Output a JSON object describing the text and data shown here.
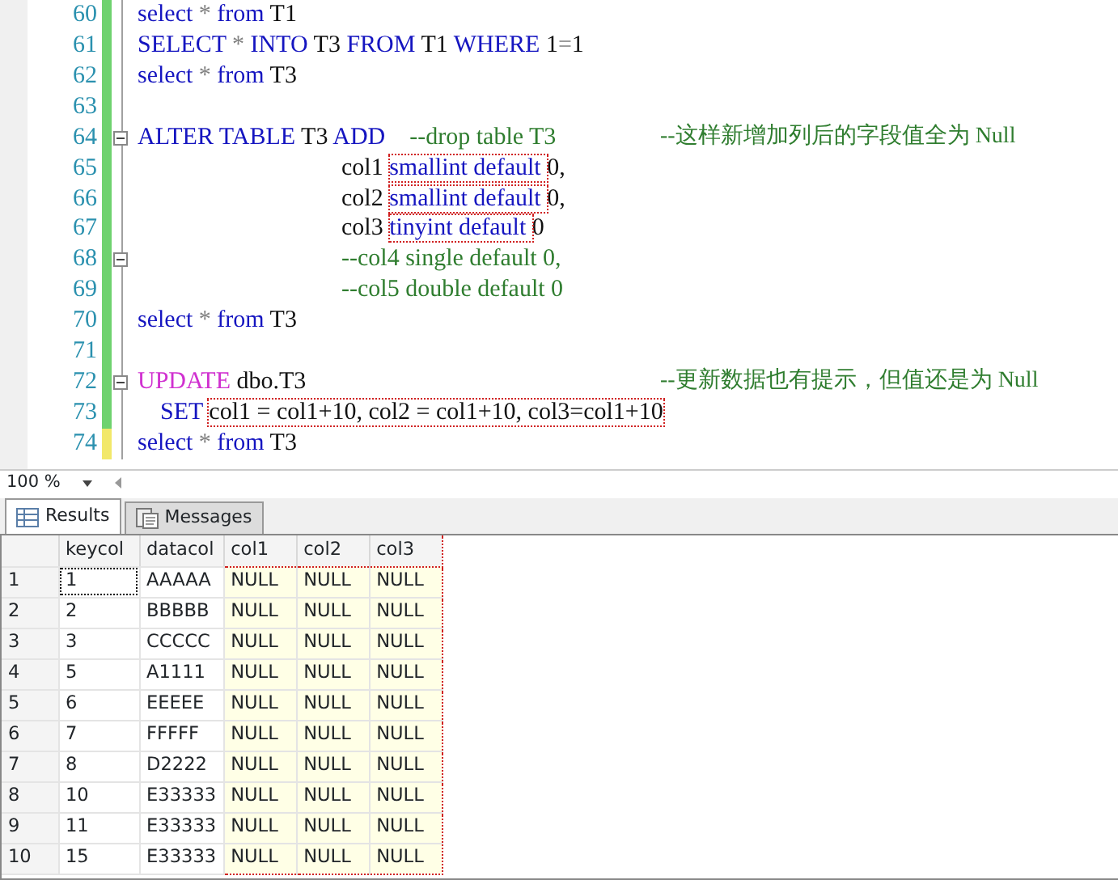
{
  "editor": {
    "lines": [
      {
        "number": "60",
        "unsaved": false,
        "fold": false,
        "kind": "plain",
        "tokens": [
          {
            "text": "select",
            "kind": "keyword"
          },
          {
            "text": " * ",
            "kind": "operator"
          },
          {
            "text": "from",
            "kind": "keyword"
          },
          {
            "text": " T1",
            "kind": "text"
          }
        ]
      },
      {
        "number": "61",
        "unsaved": false,
        "fold": false,
        "kind": "plain",
        "tokens": [
          {
            "text": "SELECT",
            "kind": "keyword"
          },
          {
            "text": " * ",
            "kind": "operator"
          },
          {
            "text": "INTO",
            "kind": "keyword"
          },
          {
            "text": " T3 ",
            "kind": "text"
          },
          {
            "text": "FROM",
            "kind": "keyword"
          },
          {
            "text": " T1 ",
            "kind": "text"
          },
          {
            "text": "WHERE",
            "kind": "keyword"
          },
          {
            "text": " 1",
            "kind": "text"
          },
          {
            "text": "=",
            "kind": "operator"
          },
          {
            "text": "1",
            "kind": "text"
          }
        ]
      },
      {
        "number": "62",
        "unsaved": false,
        "fold": false,
        "kind": "plain",
        "tokens": [
          {
            "text": "select",
            "kind": "keyword"
          },
          {
            "text": " * ",
            "kind": "operator"
          },
          {
            "text": "from",
            "kind": "keyword"
          },
          {
            "text": " T3",
            "kind": "text"
          }
        ]
      },
      {
        "number": "63",
        "unsaved": false,
        "fold": false,
        "kind": "plain"
      },
      {
        "number": "64",
        "unsaved": false,
        "fold": true,
        "kind": "plain",
        "tokens": [
          {
            "text": "ALTER TABLE",
            "kind": "keyword"
          },
          {
            "text": " T3 ",
            "kind": "text"
          },
          {
            "text": "ADD",
            "kind": "keyword"
          },
          {
            "text": "    --drop table T3",
            "kind": "comment"
          }
        ],
        "note": "--这样新增加列后的字段值全为 Null"
      },
      {
        "number": "65",
        "unsaved": false,
        "fold": false,
        "kind": "continuation",
        "tokens": [
          {
            "text": "col1 ",
            "kind": "text"
          },
          {
            "text": "smallint default ",
            "kind": "keyword",
            "boxed": true
          },
          {
            "text": "0,",
            "kind": "text"
          }
        ]
      },
      {
        "number": "66",
        "unsaved": false,
        "fold": false,
        "kind": "continuation",
        "tokens": [
          {
            "text": "col2 ",
            "kind": "text"
          },
          {
            "text": "smallint default ",
            "kind": "keyword",
            "boxed": true
          },
          {
            "text": "0,",
            "kind": "text"
          }
        ]
      },
      {
        "number": "67",
        "unsaved": false,
        "fold": false,
        "kind": "continuation",
        "tokens": [
          {
            "text": "col3 ",
            "kind": "text"
          },
          {
            "text": "tinyint default ",
            "kind": "keyword",
            "boxed": true
          },
          {
            "text": "0",
            "kind": "text"
          }
        ]
      },
      {
        "number": "68",
        "unsaved": false,
        "fold": true,
        "kind": "continuation",
        "tokens": [
          {
            "text": "--col4 single default 0,",
            "kind": "comment"
          }
        ]
      },
      {
        "number": "69",
        "unsaved": false,
        "fold": false,
        "kind": "continuation",
        "tokens": [
          {
            "text": "--col5 double default 0",
            "kind": "comment"
          }
        ]
      },
      {
        "number": "70",
        "unsaved": false,
        "fold": false,
        "kind": "plain",
        "tokens": [
          {
            "text": "select",
            "kind": "keyword"
          },
          {
            "text": " * ",
            "kind": "operator"
          },
          {
            "text": "from",
            "kind": "keyword"
          },
          {
            "text": " T3",
            "kind": "text"
          }
        ]
      },
      {
        "number": "71",
        "unsaved": false,
        "fold": false,
        "kind": "plain"
      },
      {
        "number": "72",
        "unsaved": false,
        "fold": true,
        "kind": "plain",
        "tokens": [
          {
            "text": "UPDATE",
            "kind": "function"
          },
          {
            "text": " dbo.T3",
            "kind": "text"
          }
        ],
        "note": "--更新数据也有提示，但值还是为 Null"
      },
      {
        "number": "73",
        "unsaved": false,
        "fold": false,
        "kind": "clause",
        "tokens": [
          {
            "text": "SET ",
            "kind": "keyword"
          },
          {
            "text": "col1 = col1+10, col2 = col1+10, col3=col1+10",
            "kind": "text",
            "boxed": true
          }
        ]
      },
      {
        "number": "74",
        "unsaved": true,
        "fold": false,
        "kind": "plain",
        "tokens": [
          {
            "text": "select",
            "kind": "keyword"
          },
          {
            "text": " * ",
            "kind": "operator"
          },
          {
            "text": "from",
            "kind": "keyword"
          },
          {
            "text": " T3",
            "kind": "text"
          }
        ]
      }
    ]
  },
  "zoom": "100 %",
  "tabs": [
    {
      "label": "Results",
      "selected": true
    },
    {
      "label": "Messages",
      "selected": false
    }
  ],
  "table": {
    "columns": [
      {
        "label": "keycol",
        "highlighted": false
      },
      {
        "label": "datacol",
        "highlighted": false
      },
      {
        "label": "col1",
        "highlighted": true
      },
      {
        "label": "col2",
        "highlighted": true
      },
      {
        "label": "col3",
        "highlighted": true
      }
    ],
    "rows": [
      {
        "number": "1",
        "cells": [
          "1",
          "AAAAA",
          "NULL",
          "NULL",
          "NULL"
        ]
      },
      {
        "number": "2",
        "cells": [
          "2",
          "BBBBB",
          "NULL",
          "NULL",
          "NULL"
        ]
      },
      {
        "number": "3",
        "cells": [
          "3",
          "CCCCC",
          "NULL",
          "NULL",
          "NULL"
        ]
      },
      {
        "number": "4",
        "cells": [
          "5",
          "A1111",
          "NULL",
          "NULL",
          "NULL"
        ]
      },
      {
        "number": "5",
        "cells": [
          "6",
          "EEEEE",
          "NULL",
          "NULL",
          "NULL"
        ]
      },
      {
        "number": "6",
        "cells": [
          "7",
          "FFFFF",
          "NULL",
          "NULL",
          "NULL"
        ]
      },
      {
        "number": "7",
        "cells": [
          "8",
          "D2222",
          "NULL",
          "NULL",
          "NULL"
        ]
      },
      {
        "number": "8",
        "cells": [
          "10",
          "E33333",
          "NULL",
          "NULL",
          "NULL"
        ]
      },
      {
        "number": "9",
        "cells": [
          "11",
          "E33333",
          "NULL",
          "NULL",
          "NULL"
        ]
      },
      {
        "number": "10",
        "cells": [
          "15",
          "E33333",
          "NULL",
          "NULL",
          "NULL"
        ]
      }
    ]
  }
}
